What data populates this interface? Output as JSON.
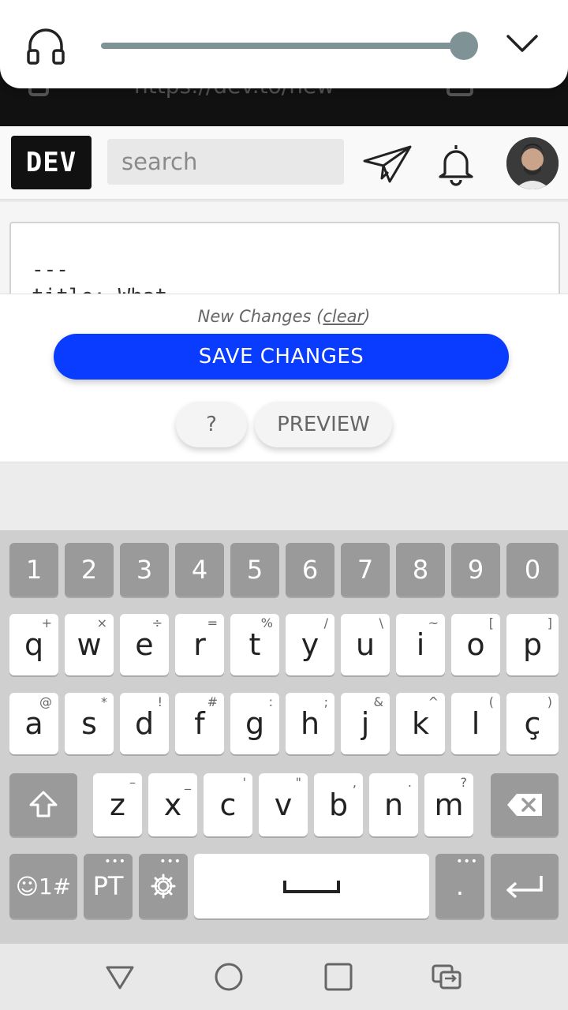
{
  "browser": {
    "url_fragment": "https://dev.to/new"
  },
  "volume": {
    "level_percent": 100,
    "accent": "#7f9396"
  },
  "header": {
    "logo": "DEV",
    "search_placeholder": "search",
    "icons": [
      "paper-plane-icon",
      "bell-icon"
    ],
    "avatar": "user-avatar"
  },
  "editor": {
    "lines": [
      "---",
      "title: What "
    ]
  },
  "actions": {
    "changes_prefix": "New Changes (",
    "clear_label": "clear",
    "changes_suffix": ")",
    "save_label": "SAVE CHANGES",
    "help_label": "?",
    "preview_label": "PREVIEW",
    "save_color": "#0a3cff"
  },
  "keyboard": {
    "numbers": [
      "1",
      "2",
      "3",
      "4",
      "5",
      "6",
      "7",
      "8",
      "9",
      "0"
    ],
    "row1": [
      "q",
      "w",
      "e",
      "r",
      "t",
      "y",
      "u",
      "i",
      "o",
      "p"
    ],
    "row1_alt": [
      "+",
      "×",
      "÷",
      "=",
      "%",
      "/",
      "\\",
      "~",
      "[",
      "]"
    ],
    "row2": [
      "a",
      "s",
      "d",
      "f",
      "g",
      "h",
      "j",
      "k",
      "l",
      "ç"
    ],
    "row2_alt": [
      "@",
      "*",
      "!",
      "#",
      ":",
      ";",
      "&",
      "^",
      "(",
      ")"
    ],
    "row3": [
      "z",
      "x",
      "c",
      "v",
      "b",
      "n",
      "m"
    ],
    "row3_alt": [
      "–",
      "_",
      "'",
      "\"",
      ",",
      ".",
      "?"
    ],
    "symbols_label": "☺1#",
    "language_label": "PT",
    "dots": "•••"
  },
  "navbar": {
    "icons": [
      "back-triangle-icon",
      "home-circle-icon",
      "recents-square-icon",
      "switch-apps-icon"
    ]
  }
}
